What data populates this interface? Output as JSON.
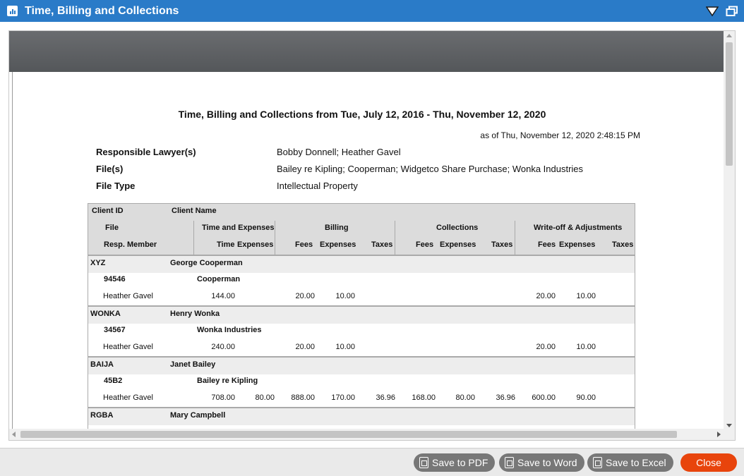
{
  "window": {
    "title": "Time, Billing and Collections"
  },
  "report": {
    "title": "Time, Billing and Collections from Tue, July 12, 2016 - Thu, November 12, 2020",
    "as_of": "as of Thu, November 12, 2020  2:48:15 PM",
    "meta": [
      {
        "label": "Responsible Lawyer(s)",
        "value": "Bobby Donnell; Heather Gavel"
      },
      {
        "label": "File(s)",
        "value": "Bailey re Kipling; Cooperman; Widgetco Share Purchase; Wonka Industries"
      },
      {
        "label": "File Type",
        "value": "Intellectual Property"
      }
    ],
    "headers": {
      "client_id": "Client ID",
      "client_name": "Client Name",
      "file": "File",
      "resp_member": "Resp. Member",
      "time_and_expenses": "Time and Expenses",
      "time": "Time",
      "expenses": "Expenses",
      "billing": "Billing",
      "fees": "Fees",
      "billing_expenses": "Expenses",
      "taxes": "Taxes",
      "collections": "Collections",
      "coll_fees": "Fees",
      "coll_expenses": "Expenses",
      "coll_taxes": "Taxes",
      "writeoff": "Write-off & Adjustments",
      "wo_fees": "Fees",
      "wo_expenses": "Expenses",
      "wo_taxes": "Taxes"
    },
    "groups": [
      {
        "client_id": "XYZ",
        "client_name": "George Cooperman",
        "file_no": "94546",
        "file_name": "Cooperman",
        "member": "Heather Gavel",
        "time": "144.00",
        "expenses": "",
        "fees": "20.00",
        "bill_expenses": "10.00",
        "taxes": "",
        "coll_fees": "",
        "coll_expenses": "",
        "coll_taxes": "",
        "wo_fees": "20.00",
        "wo_expenses": "10.00",
        "wo_taxes": ""
      },
      {
        "client_id": "WONKA",
        "client_name": "Henry Wonka",
        "file_no": "34567",
        "file_name": "Wonka Industries",
        "member": "Heather Gavel",
        "time": "240.00",
        "expenses": "",
        "fees": "20.00",
        "bill_expenses": "10.00",
        "taxes": "",
        "coll_fees": "",
        "coll_expenses": "",
        "coll_taxes": "",
        "wo_fees": "20.00",
        "wo_expenses": "10.00",
        "wo_taxes": ""
      },
      {
        "client_id": "BAIJA",
        "client_name": "Janet Bailey",
        "file_no": "45B2",
        "file_name": "Bailey re Kipling",
        "member": "Heather Gavel",
        "time": "708.00",
        "expenses": "80.00",
        "fees": "888.00",
        "bill_expenses": "170.00",
        "taxes": "36.96",
        "coll_fees": "168.00",
        "coll_expenses": "80.00",
        "coll_taxes": "36.96",
        "wo_fees": "600.00",
        "wo_expenses": "90.00",
        "wo_taxes": ""
      },
      {
        "client_id": "RGBA",
        "client_name": "Mary Campbell"
      }
    ]
  },
  "footer": {
    "save_pdf": "Save to PDF",
    "save_word": "Save to Word",
    "save_excel": "Save to Excel",
    "close": "Close"
  },
  "colors": {
    "titlebar": "#2a7bc8",
    "close_button": "#e8440c",
    "header_bg": "#dcdcdc"
  }
}
